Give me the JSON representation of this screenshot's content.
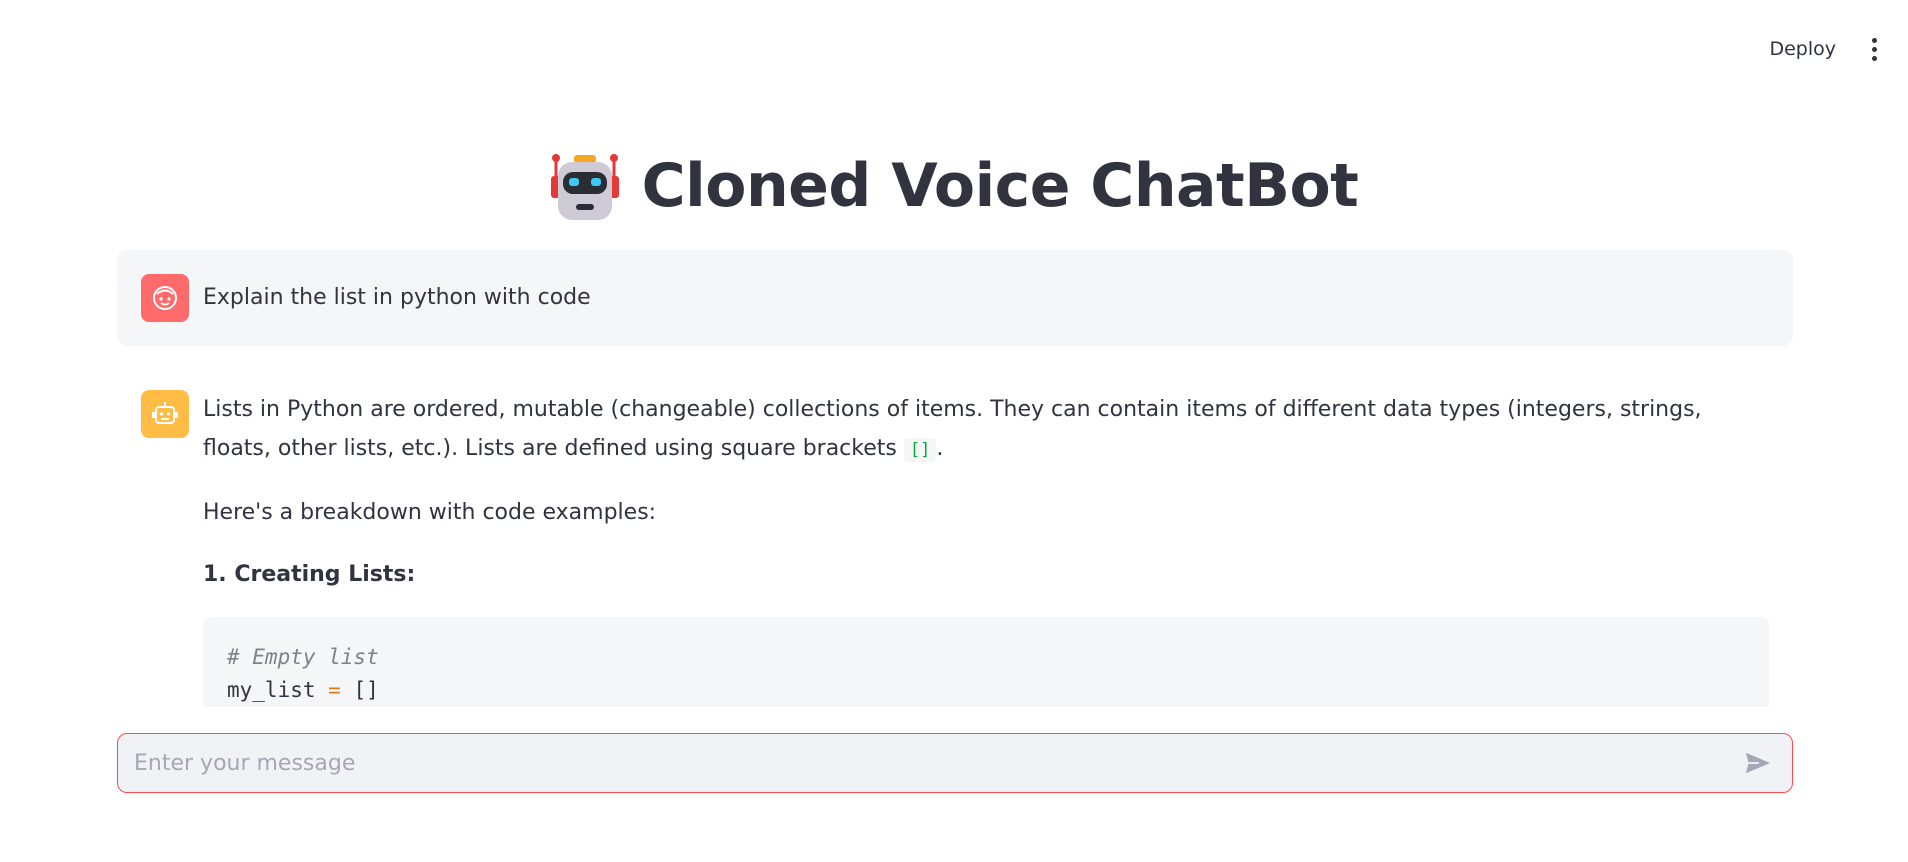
{
  "header": {
    "deploy_label": "Deploy",
    "menu_icon": "kebab-menu-icon"
  },
  "title": {
    "emoji_icon": "robot-face-icon",
    "text": "Cloned Voice ChatBot"
  },
  "chat": {
    "messages": [
      {
        "role": "user",
        "avatar_icon": "user-face-icon",
        "text": "Explain the list in python with code"
      },
      {
        "role": "assistant",
        "avatar_icon": "bot-face-icon",
        "paragraph1_a": "Lists in Python are ordered, mutable (changeable) collections of items. They can contain items of different data types (integers, strings, floats, other lists, etc.). Lists are defined using square brackets ",
        "paragraph1_code": "[]",
        "paragraph1_b": ".",
        "paragraph2": "Here's a breakdown with code examples:",
        "heading1": "1. Creating Lists:",
        "code": {
          "comment": "# Empty list",
          "line2_var": "my_list ",
          "line2_op": "=",
          "line2_val": " []"
        }
      }
    ]
  },
  "input": {
    "placeholder": "Enter your message",
    "value": "",
    "send_icon": "send-icon"
  },
  "colors": {
    "accent": "#ff4b4b",
    "user_avatar": "#ff6b6b",
    "bot_avatar": "#ffbd45",
    "code_green": "#09ab3b"
  }
}
